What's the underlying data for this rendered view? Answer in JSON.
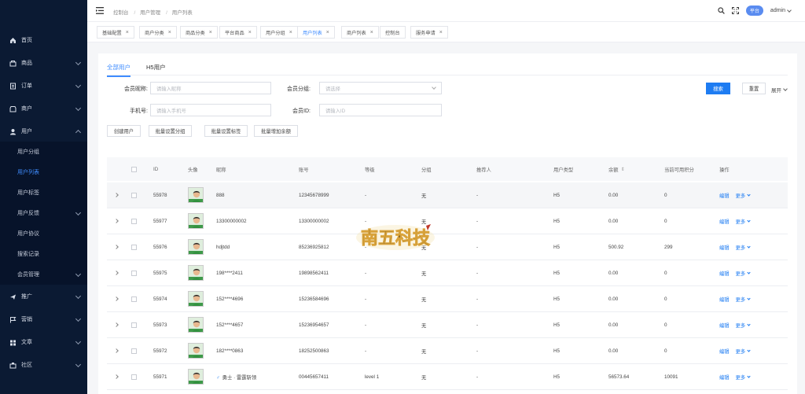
{
  "sidebar": {
    "items": [
      {
        "label": "首页",
        "icon": "home-icon",
        "expandable": false
      },
      {
        "label": "商品",
        "icon": "goods-icon",
        "expandable": true
      },
      {
        "label": "订单",
        "icon": "order-icon",
        "expandable": true
      },
      {
        "label": "商户",
        "icon": "merchant-icon",
        "expandable": true
      },
      {
        "label": "用户",
        "icon": "user-icon",
        "expandable": true,
        "open": true
      }
    ],
    "sub_items": [
      {
        "label": "用户分组",
        "active": false
      },
      {
        "label": "用户列表",
        "active": true
      },
      {
        "label": "用户标签",
        "active": false
      },
      {
        "label": "用户反馈",
        "active": false,
        "expandable": true
      },
      {
        "label": "用户协议",
        "active": false
      },
      {
        "label": "搜索记录",
        "active": false
      },
      {
        "label": "会员管理",
        "active": false,
        "expandable": true
      }
    ],
    "items_bottom": [
      {
        "label": "推广",
        "icon": "promote-icon"
      },
      {
        "label": "营销",
        "icon": "marketing-icon"
      },
      {
        "label": "文章",
        "icon": "article-icon"
      },
      {
        "label": "社区",
        "icon": "community-icon"
      }
    ]
  },
  "topbar": {
    "breadcrumb": [
      "控制台",
      "用户管理",
      "用户列表"
    ],
    "platform_badge": "平台",
    "user": "admin"
  },
  "tabs": [
    {
      "label": "基础配置",
      "closable": true
    },
    {
      "label": "商户分类",
      "closable": true
    },
    {
      "label": "商品分类",
      "closable": true
    },
    {
      "label": "平台商品",
      "closable": true
    },
    {
      "label": "用户分组",
      "closable": true
    },
    {
      "label": "用户列表",
      "closable": true,
      "active": true
    },
    {
      "label": "商户列表",
      "closable": true
    },
    {
      "label": "控制台",
      "closable": false
    },
    {
      "label": "服务申请",
      "closable": true
    }
  ],
  "subtabs": [
    "全部用户",
    "H5用户"
  ],
  "filters": {
    "nickname_label": "会员昵称:",
    "nickname_placeholder": "请输入昵称",
    "group_label": "会员分组:",
    "group_placeholder": "请选择",
    "phone_label": "手机号:",
    "phone_placeholder": "请输入手机号",
    "id_label": "会员ID:",
    "id_placeholder": "请输入ID",
    "search_btn": "搜索",
    "reset_btn": "重置",
    "expand_btn": "展开"
  },
  "actions": [
    "创建用户",
    "批量设置分组",
    "批量设置标签",
    "批量增加余额"
  ],
  "table": {
    "columns": [
      "ID",
      "头像",
      "昵称",
      "账号",
      "等级",
      "分组",
      "推荐人",
      "用户类型",
      "余额",
      "当前可用积分",
      "操作"
    ],
    "edit_label": "编辑",
    "more_label": "更多",
    "rows": [
      {
        "id": "55978",
        "nickname": "888",
        "gender": "",
        "account": "12345678999",
        "level": "-",
        "group": "无",
        "referrer": "-",
        "type": "H5",
        "balance": "0.00",
        "points": "0"
      },
      {
        "id": "55977",
        "nickname": "13300000002",
        "gender": "",
        "account": "13300000002",
        "level": "-",
        "group": "无",
        "referrer": "-",
        "type": "H5",
        "balance": "0.00",
        "points": "0"
      },
      {
        "id": "55976",
        "nickname": "hdjtdd",
        "gender": "",
        "account": "85236925812",
        "level": "-",
        "group": "无",
        "referrer": "-",
        "type": "H5",
        "balance": "500.92",
        "points": "299"
      },
      {
        "id": "55975",
        "nickname": "198****2411",
        "gender": "",
        "account": "19898562411",
        "level": "-",
        "group": "无",
        "referrer": "-",
        "type": "H5",
        "balance": "0.00",
        "points": "0"
      },
      {
        "id": "55974",
        "nickname": "152****4696",
        "gender": "",
        "account": "15236584696",
        "level": "-",
        "group": "无",
        "referrer": "-",
        "type": "H5",
        "balance": "0.00",
        "points": "0"
      },
      {
        "id": "55973",
        "nickname": "152****4657",
        "gender": "",
        "account": "15236954657",
        "level": "-",
        "group": "无",
        "referrer": "-",
        "type": "H5",
        "balance": "0.00",
        "points": "0"
      },
      {
        "id": "55972",
        "nickname": "182****0863",
        "gender": "",
        "account": "18252500863",
        "level": "-",
        "group": "无",
        "referrer": "-",
        "type": "H5",
        "balance": "0.00",
        "points": "0"
      },
      {
        "id": "55971",
        "nickname": "勇士 · 雷霆斩领",
        "gender": "♂",
        "account": "00445657411",
        "level": "level 1",
        "group": "无",
        "referrer": "-",
        "type": "H5",
        "balance": "56573.64",
        "points": "10091"
      }
    ]
  },
  "watermark_text": "南五科技"
}
